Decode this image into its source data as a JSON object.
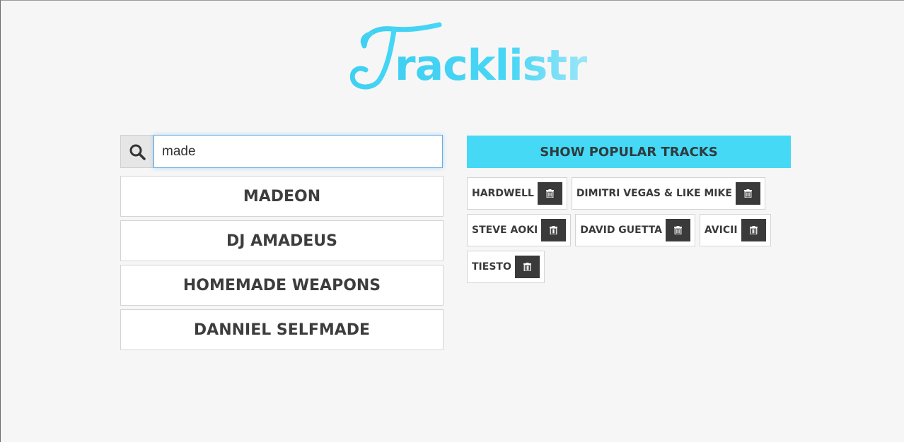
{
  "app": {
    "logo_initial": "T",
    "logo_rest": "racklistr",
    "brand_color": "#45d9f5"
  },
  "search": {
    "value": "made",
    "icon": "search-icon"
  },
  "results": [
    {
      "label": "MADEON"
    },
    {
      "label": "DJ AMADEUS"
    },
    {
      "label": "HOMEMADE WEAPONS"
    },
    {
      "label": "DANNIEL SELFMADE"
    }
  ],
  "popular_button": {
    "label": "SHOW POPULAR TRACKS"
  },
  "selected_artists": [
    {
      "label": "HARDWELL"
    },
    {
      "label": "DIMITRI VEGAS & LIKE MIKE"
    },
    {
      "label": "STEVE AOKI"
    },
    {
      "label": "DAVID GUETTA"
    },
    {
      "label": "AVICII"
    },
    {
      "label": "TIESTO"
    }
  ],
  "delete_icon": "trash-icon"
}
